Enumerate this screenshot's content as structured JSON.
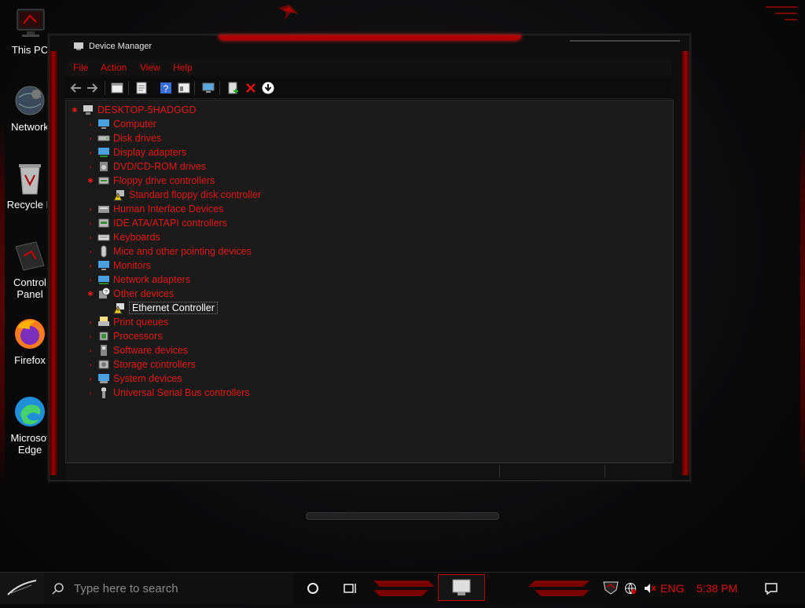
{
  "colors": {
    "accent": "#e01010",
    "bg": "#0b0b0c",
    "panel": "#1a1a1b"
  },
  "desktop": {
    "icons": [
      {
        "label": "This PC",
        "icon": "monitor-icon"
      },
      {
        "label": "Network",
        "icon": "network-globe-icon"
      },
      {
        "label": "Recycle B",
        "icon": "recycle-bin-icon"
      },
      {
        "label": "Control Panel",
        "icon": "control-panel-icon"
      },
      {
        "label": "Firefox",
        "icon": "firefox-icon"
      },
      {
        "label": "Microsof Edge",
        "icon": "edge-icon"
      }
    ]
  },
  "window": {
    "title": "Device Manager",
    "menu": [
      "File",
      "Action",
      "View",
      "Help"
    ],
    "toolbar": [
      "back-icon",
      "forward-icon",
      "properties-pane-icon",
      "properties-icon",
      "help-icon",
      "view-icon",
      "monitor-scan-icon",
      "add-driver-icon",
      "uninstall-icon",
      "update-driver-icon"
    ]
  },
  "tree": {
    "root": "DESKTOP-5HADGGD",
    "items": [
      {
        "label": "Computer",
        "expanded": false
      },
      {
        "label": "Disk drives",
        "expanded": false
      },
      {
        "label": "Display adapters",
        "expanded": false
      },
      {
        "label": "DVD/CD-ROM drives",
        "expanded": false
      },
      {
        "label": "Floppy drive controllers",
        "expanded": true
      },
      {
        "label": "Standard floppy disk controller",
        "child": true,
        "warning": true
      },
      {
        "label": "Human Interface Devices",
        "expanded": false
      },
      {
        "label": "IDE ATA/ATAPI controllers",
        "expanded": false
      },
      {
        "label": "Keyboards",
        "expanded": false
      },
      {
        "label": "Mice and other pointing devices",
        "expanded": false
      },
      {
        "label": "Monitors",
        "expanded": false
      },
      {
        "label": "Network adapters",
        "expanded": false
      },
      {
        "label": "Other devices",
        "expanded": true
      },
      {
        "label": "Ethernet Controller",
        "child": true,
        "warning": true,
        "selected": true
      },
      {
        "label": "Print queues",
        "expanded": false
      },
      {
        "label": "Processors",
        "expanded": false
      },
      {
        "label": "Software devices",
        "expanded": false
      },
      {
        "label": "Storage controllers",
        "expanded": false
      },
      {
        "label": "System devices",
        "expanded": false
      },
      {
        "label": "Universal Serial Bus controllers",
        "expanded": false
      }
    ]
  },
  "taskbar": {
    "search_placeholder": "Type here to search",
    "language": "ENG",
    "time": "5:38 PM"
  }
}
